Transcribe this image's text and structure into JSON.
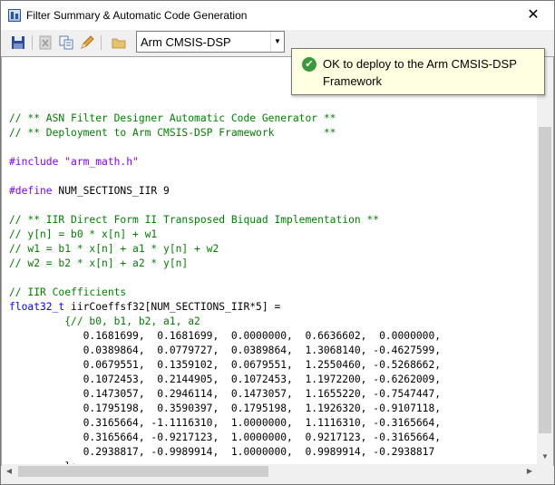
{
  "window": {
    "title": "Filter Summary & Automatic Code Generation"
  },
  "toolbar": {
    "buttons": [
      {
        "name": "save-icon"
      },
      {
        "name": "excel-icon"
      },
      {
        "name": "copy-icon"
      },
      {
        "name": "pencil-icon"
      },
      {
        "name": "folder-icon"
      }
    ],
    "target_select": "Arm CMSIS-DSP"
  },
  "toast": {
    "icon": "check-circle-icon",
    "text": "OK to deploy to the Arm CMSIS-DSP Framework"
  },
  "code": [
    {
      "text": "",
      "cls": "plain"
    },
    {
      "text": "// ** ASN Filter Designer Automatic Code Generator **",
      "cls": "comment"
    },
    {
      "text": "// ** Deployment to Arm CMSIS-DSP Framework        **",
      "cls": "comment"
    },
    {
      "text": "",
      "cls": "plain"
    },
    {
      "text": "#include \"arm_math.h\"",
      "cls": "pre"
    },
    {
      "text": "",
      "cls": "plain"
    },
    {
      "text": "#define NUM_SECTIONS_IIR 9",
      "cls": "pre"
    },
    {
      "text": "",
      "cls": "plain"
    },
    {
      "text": "// ** IIR Direct Form II Transposed Biquad Implementation **",
      "cls": "comment"
    },
    {
      "text": "// y[n] = b0 * x[n] + w1",
      "cls": "comment"
    },
    {
      "text": "// w1 = b1 * x[n] + a1 * y[n] + w2",
      "cls": "comment"
    },
    {
      "text": "// w2 = b2 * x[n] + a2 * y[n]",
      "cls": "comment"
    },
    {
      "text": "",
      "cls": "plain"
    },
    {
      "text": "// IIR Coefficients",
      "cls": "comment"
    },
    {
      "text": "float32_t iirCoeffsf32[NUM_SECTIONS_IIR*5] =",
      "cls": "decl"
    },
    {
      "text": "         {// b0, b1, b2, a1, a2",
      "cls": "comment"
    },
    {
      "text": "            0.1681699,  0.1681699,  0.0000000,  0.6636602,  0.0000000,",
      "cls": "plain"
    },
    {
      "text": "            0.0389864,  0.0779727,  0.0389864,  1.3068140, -0.4627599,",
      "cls": "plain"
    },
    {
      "text": "            0.0679551,  0.1359102,  0.0679551,  1.2550460, -0.5268662,",
      "cls": "plain"
    },
    {
      "text": "            0.1072453,  0.2144905,  0.1072453,  1.1972200, -0.6262009,",
      "cls": "plain"
    },
    {
      "text": "            0.1473057,  0.2946114,  0.1473057,  1.1655220, -0.7547447,",
      "cls": "plain"
    },
    {
      "text": "            0.1795198,  0.3590397,  0.1795198,  1.1926320, -0.9107118,",
      "cls": "plain"
    },
    {
      "text": "            0.3165664, -1.1116310,  1.0000000,  1.1116310, -0.3165664,",
      "cls": "plain"
    },
    {
      "text": "            0.3165664, -0.9217123,  1.0000000,  0.9217123, -0.3165664,",
      "cls": "plain"
    },
    {
      "text": "            0.2938817, -0.9989914,  1.0000000,  0.9989914, -0.2938817",
      "cls": "plain"
    },
    {
      "text": "         };",
      "cls": "plain"
    }
  ]
}
